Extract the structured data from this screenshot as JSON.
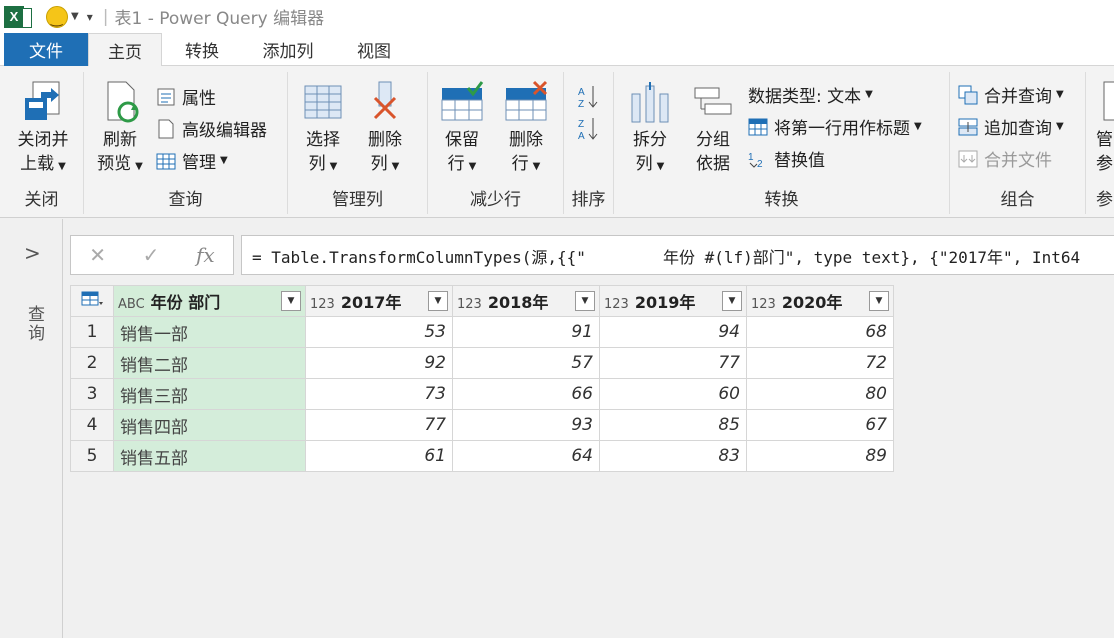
{
  "window": {
    "title": "表1 - Power Query 编辑器",
    "app_logo_text": "X"
  },
  "tabs": {
    "file": "文件",
    "items": [
      "主页",
      "转换",
      "添加列",
      "视图"
    ]
  },
  "ribbon": {
    "close_group": {
      "label": "关闭",
      "close_load": [
        "关闭并",
        "上载"
      ]
    },
    "query_group": {
      "label": "查询",
      "refresh": [
        "刷新",
        "预览"
      ],
      "properties": "属性",
      "advanced_editor": "高级编辑器",
      "manage": "管理"
    },
    "manage_columns_group": {
      "label": "管理列",
      "choose_columns": [
        "选择",
        "列"
      ],
      "remove_columns": [
        "删除",
        "列"
      ]
    },
    "reduce_rows_group": {
      "label": "减少行",
      "keep_rows": [
        "保留",
        "行"
      ],
      "remove_rows": [
        "删除",
        "行"
      ]
    },
    "sort_group": {
      "label": "排序"
    },
    "transform_group": {
      "label": "转换",
      "split_column": [
        "拆分",
        "列"
      ],
      "group_by": [
        "分组",
        "依据"
      ],
      "data_type": "数据类型: 文本",
      "use_first_row": "将第一行用作标题",
      "replace_values": "替换值"
    },
    "combine_group": {
      "label": "组合",
      "merge_queries": "合并查询",
      "append_queries": "追加查询",
      "combine_files": "合并文件"
    },
    "params_group": {
      "label": "参",
      "manage_params": [
        "管",
        "参"
      ]
    }
  },
  "query_pane": {
    "label": "查询"
  },
  "formula_bar": {
    "formula": "= Table.TransformColumnTypes(源,{{\"        年份 #(lf)部门\", type text}, {\"2017年\", Int64"
  },
  "table": {
    "columns": [
      {
        "type_icon": "ABC",
        "name": "年份 部门"
      },
      {
        "type_icon": "123",
        "name": "2017年"
      },
      {
        "type_icon": "123",
        "name": "2018年"
      },
      {
        "type_icon": "123",
        "name": "2019年"
      },
      {
        "type_icon": "123",
        "name": "2020年"
      }
    ],
    "rows": [
      {
        "index": "1",
        "cells": [
          "销售一部",
          "53",
          "91",
          "94",
          "68"
        ]
      },
      {
        "index": "2",
        "cells": [
          "销售二部",
          "92",
          "57",
          "77",
          "72"
        ]
      },
      {
        "index": "3",
        "cells": [
          "销售三部",
          "73",
          "66",
          "60",
          "80"
        ]
      },
      {
        "index": "4",
        "cells": [
          "销售四部",
          "77",
          "93",
          "85",
          "67"
        ]
      },
      {
        "index": "5",
        "cells": [
          "销售五部",
          "61",
          "64",
          "83",
          "89"
        ]
      }
    ]
  },
  "colors": {
    "file_tab": "#1f6fb5",
    "selected_column": "#d4edda",
    "excel_green": "#1d6f42"
  }
}
